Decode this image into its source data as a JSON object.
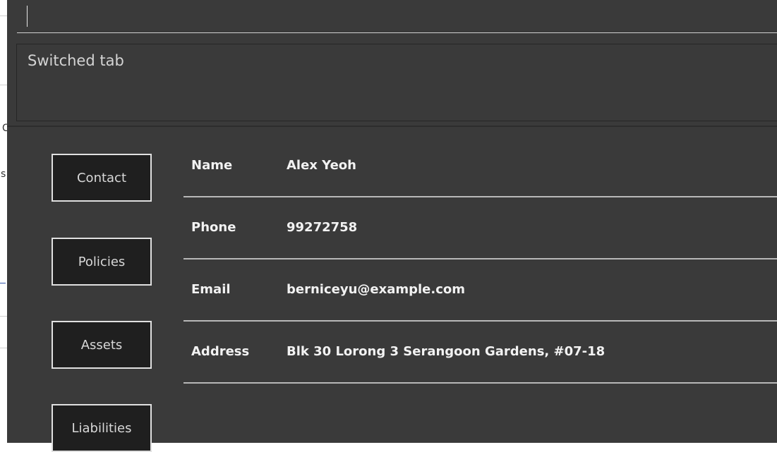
{
  "command_box": {
    "value": ""
  },
  "result_display": {
    "text": "Switched tab"
  },
  "tabs": [
    {
      "label": "Contact"
    },
    {
      "label": "Policies"
    },
    {
      "label": "Assets"
    },
    {
      "label": "Liabilities"
    }
  ],
  "details": [
    {
      "label": "Name",
      "value": "Alex Yeoh"
    },
    {
      "label": "Phone",
      "value": "99272758"
    },
    {
      "label": "Email",
      "value": "berniceyu@example.com"
    },
    {
      "label": "Address",
      "value": "Blk 30 Lorong 3 Serangoon Gardens, #07-18"
    }
  ],
  "background_window": {
    "char_1": "C",
    "char_2": "s"
  }
}
